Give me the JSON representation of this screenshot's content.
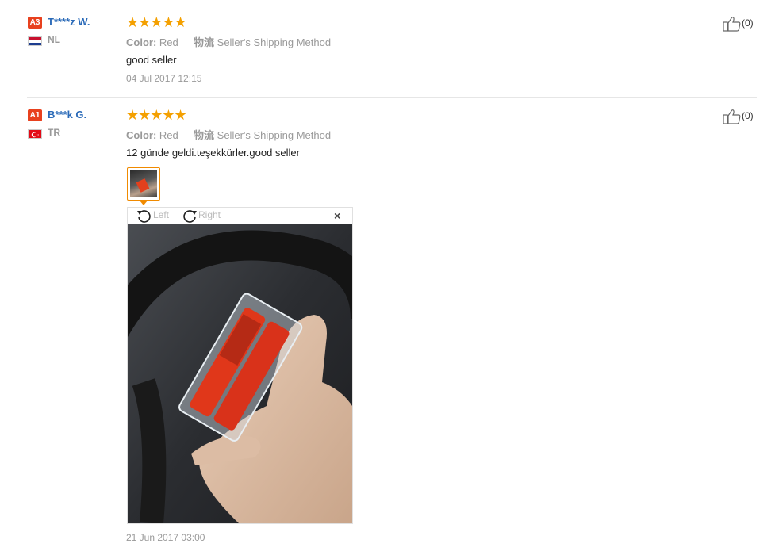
{
  "reviews": [
    {
      "level": "A3",
      "username": "T****z W.",
      "country": "NL",
      "stars": "★★★★★",
      "color_label": "Color:",
      "color_value": "Red",
      "shipping_label": "物流",
      "shipping_value": "Seller's Shipping Method",
      "text": "good seller",
      "date": "04 Jul 2017 12:15",
      "helpful_count": "(0)"
    },
    {
      "level": "A1",
      "username": "B***k G.",
      "country": "TR",
      "stars": "★★★★★",
      "color_label": "Color:",
      "color_value": "Red",
      "shipping_label": "物流",
      "shipping_value": "Seller's Shipping Method",
      "text": "12 günde geldi.teşekkürler.good seller",
      "date": "21 Jun 2017 03:00",
      "helpful_count": "(0)"
    }
  ],
  "viewer": {
    "rotate_left": "Left",
    "rotate_right": "Right",
    "close": "×"
  },
  "colors": {
    "level_badge": "#e8411e",
    "username": "#2a6ab8",
    "stars": "#f4a000",
    "thumb_border": "#f08a00"
  }
}
